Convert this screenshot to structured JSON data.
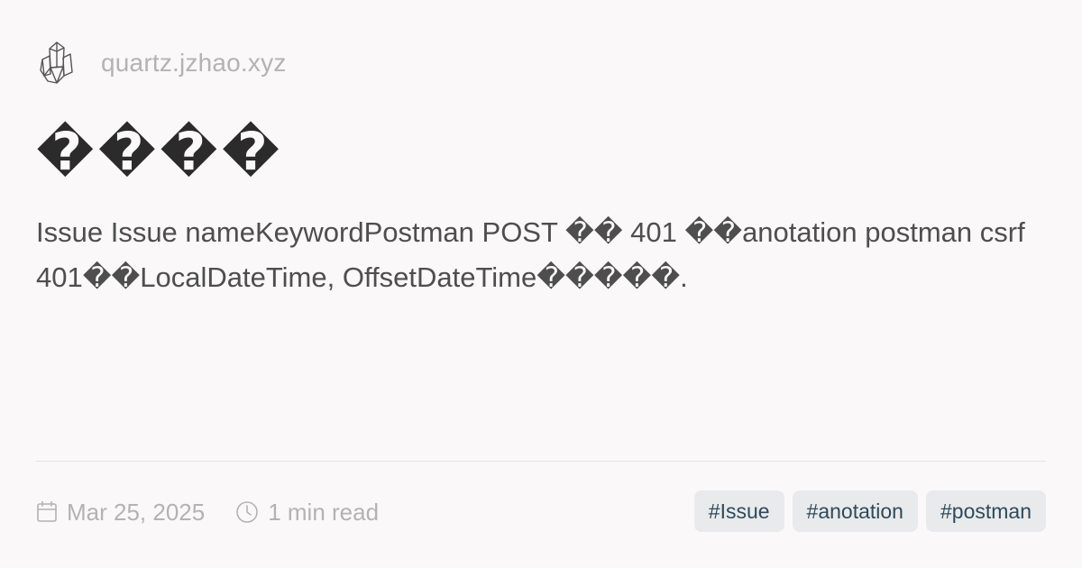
{
  "site": {
    "logo_icon": "crystal-icon",
    "domain": "quartz.jzhao.xyz"
  },
  "page": {
    "title": "����",
    "description": "Issue Issue nameKeywordPostman POST �� 401 ��anotation postman csrf 401��LocalDateTime, OffsetDateTime�����."
  },
  "meta": {
    "date_icon": "calendar-icon",
    "date": "Mar 25, 2025",
    "read_icon": "clock-icon",
    "read_time": "1 min read"
  },
  "tags": [
    "#Issue",
    "#anotation",
    "#postman"
  ],
  "colors": {
    "background": "#faf8f8",
    "muted_text": "#b3b3b3",
    "tag_background": "#e9eaeb",
    "tag_text": "#2e4a5c"
  }
}
